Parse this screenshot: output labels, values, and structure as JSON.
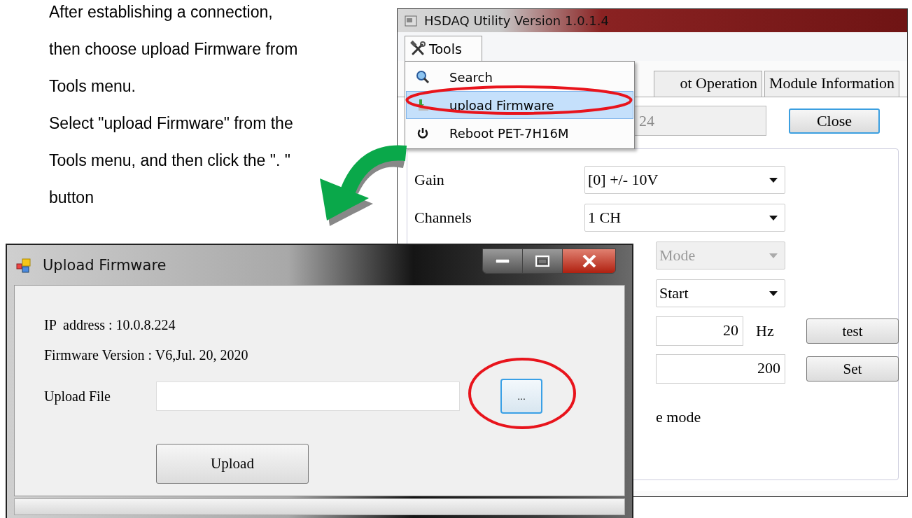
{
  "instructions": [
    {
      "lines": [
        "After establishing a connection,",
        "then choose upload Firmware from",
        "Tools menu."
      ]
    },
    {
      "lines": [
        "Select \"upload Firmware\" from the",
        "Tools menu, and then click the \".  \"",
        "button"
      ]
    }
  ],
  "main_window": {
    "title": "HSDAQ Utility Version 1.0.1.4",
    "menu": {
      "label": "Tools",
      "open": true,
      "items": [
        {
          "label": "Search",
          "kind": "search",
          "selected": false
        },
        {
          "label": "upload Firmware",
          "kind": "upload",
          "selected": true
        },
        {
          "label": "Reboot PET-7H16M",
          "kind": "power",
          "selected": false
        }
      ]
    },
    "tabs": [
      {
        "label": "ot Operation",
        "selected": false
      },
      {
        "label": "Module Information",
        "selected": false
      }
    ],
    "address_field": {
      "value": "24"
    },
    "close_button": "Close",
    "settings": [
      {
        "kind": "combo",
        "label": "Gain",
        "value": "[0] +/- 10V",
        "disabled": false
      },
      {
        "kind": "combo",
        "label": "Channels",
        "value": "1 CH",
        "disabled": false
      },
      {
        "kind": "combo",
        "value": "Mode",
        "disabled": true
      },
      {
        "kind": "combo",
        "value": "Start",
        "disabled": false
      },
      {
        "kind": "number",
        "value": "20",
        "unit": "Hz",
        "button": "test"
      },
      {
        "kind": "number",
        "value": "200",
        "button": "Set"
      },
      {
        "kind": "text",
        "value": "e mode"
      }
    ]
  },
  "upload_window": {
    "title": "Upload Firmware",
    "ip_address": "IP  address : 10.0.8.224",
    "firmware_version": "Firmware Version : V6,Jul. 20, 2020",
    "file_label": "Upload File",
    "browse_button": "...",
    "upload_button": "Upload"
  }
}
